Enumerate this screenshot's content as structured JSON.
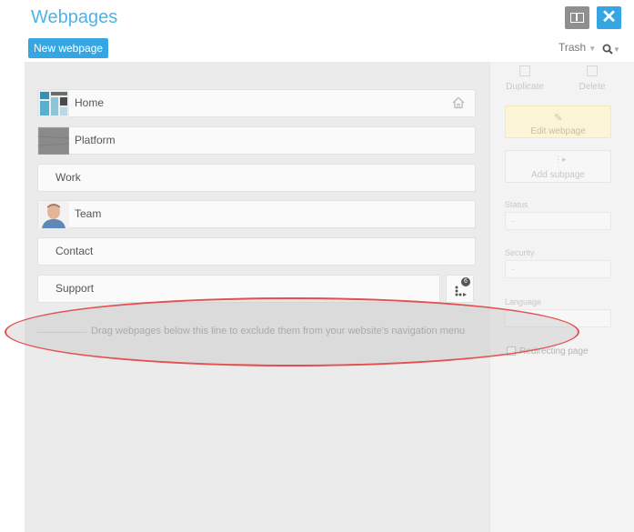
{
  "header": {
    "title": "Webpages",
    "new_button": "New webpage",
    "trash_label": "Trash",
    "close_label": "✕"
  },
  "pages": [
    {
      "label": "Home",
      "thumb": "home-thumbnail"
    },
    {
      "label": "Platform",
      "thumb": "platform-thumbnail"
    },
    {
      "label": "Work",
      "thumb": null
    },
    {
      "label": "Team",
      "thumb": "team-thumbnail"
    },
    {
      "label": "Contact",
      "thumb": null
    },
    {
      "label": "Support",
      "thumb": null
    }
  ],
  "menu_badge": "6",
  "divider_text": "Drag webpages below this line to exclude them from your website's navigation menu",
  "side": {
    "duplicate": "Duplicate",
    "delete": "Delete",
    "edit": "Edit webpage",
    "add_subpage": "Add subpage",
    "status_label": "Status",
    "security_label": "Security",
    "language_label": "Language",
    "redirect_label": "Redirecting page",
    "select_placeholder": "-"
  },
  "colors": {
    "accent": "#35a6e3",
    "title": "#4fb3e6",
    "highlight_ring": "#e25050"
  }
}
